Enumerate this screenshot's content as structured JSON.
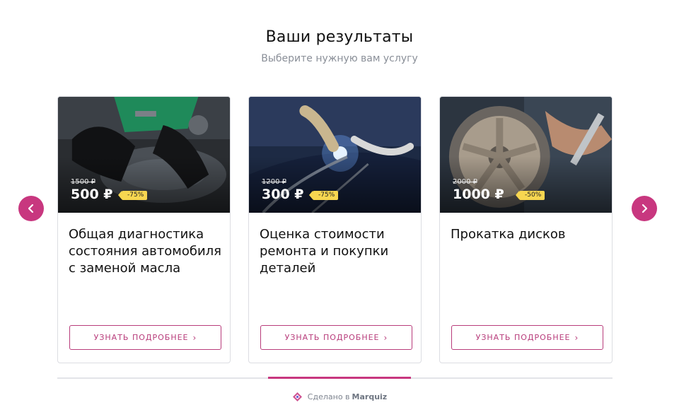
{
  "header": {
    "title": "Ваши результаты",
    "subtitle": "Выберите нужную вам услугу"
  },
  "cards": [
    {
      "old_price": "1500 ₽",
      "new_price": "500 ₽",
      "discount": "-75%",
      "title": "Общая диагностика состояния автомобиля с заменой масла",
      "button": "УЗНАТЬ ПОДРОБНЕЕ",
      "image": "engine-mechanic-photo"
    },
    {
      "old_price": "1200 ₽",
      "new_price": "300 ₽",
      "discount": "-75%",
      "title": "Оценка стоимости ремонта и покупки деталей",
      "button": "УЗНАТЬ ПОДРОБНЕЕ",
      "image": "welding-photo"
    },
    {
      "old_price": "2000 ₽",
      "new_price": "1000 ₽",
      "discount": "-50%",
      "title": "Прокатка дисков",
      "button": "УЗНАТЬ ПОДРОБНЕЕ",
      "image": "wheel-rims-photo"
    }
  ],
  "footer": {
    "made_in": "Сделано в",
    "brand": "Marquiz"
  },
  "colors": {
    "accent": "#c8377f",
    "discount_badge": "#f7d650"
  }
}
